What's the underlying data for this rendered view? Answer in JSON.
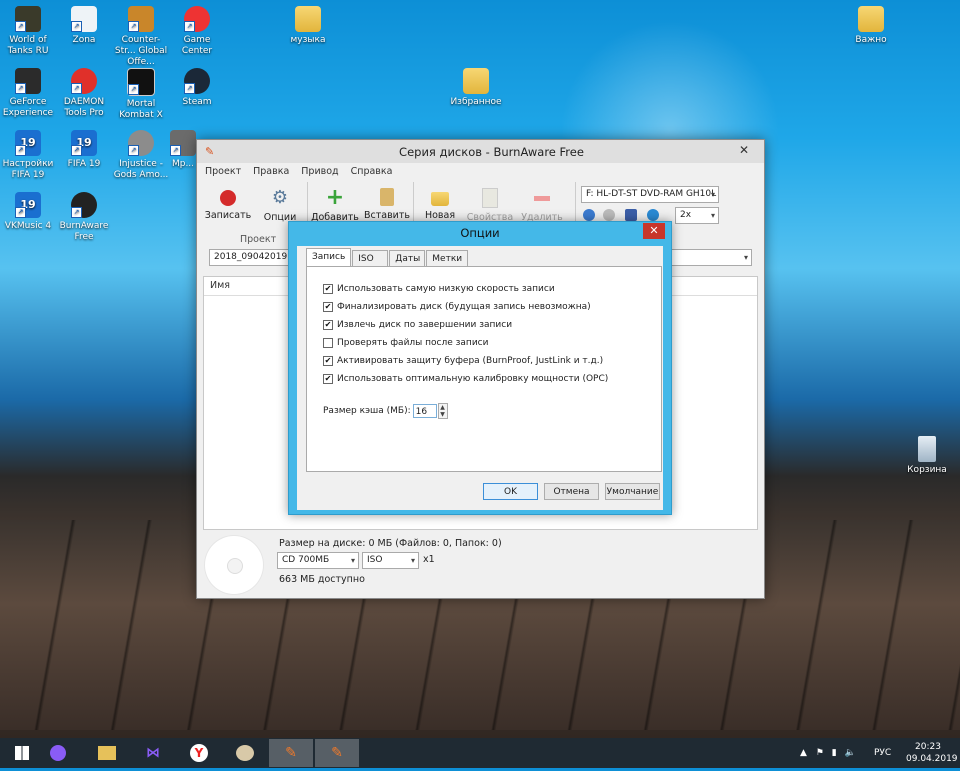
{
  "desktop": {
    "icons": [
      {
        "label": "World of Tanks RU",
        "icon": "wot-icon"
      },
      {
        "label": "Zona",
        "icon": "zona-icon"
      },
      {
        "label": "Counter-Str... Global Offe...",
        "icon": "csgo-icon"
      },
      {
        "label": "Game Center",
        "icon": "game-center-icon"
      },
      {
        "label": "музыка",
        "icon": "folder-icon"
      },
      {
        "label": "Важно",
        "icon": "folder-icon"
      },
      {
        "label": "GeForce Experience",
        "icon": "geforce-icon"
      },
      {
        "label": "DAEMON Tools Pro",
        "icon": "daemon-icon"
      },
      {
        "label": "Mortal Kombat X",
        "icon": "mkx-icon"
      },
      {
        "label": "Steam",
        "icon": "steam-icon"
      },
      {
        "label": "Избранное",
        "icon": "folder-icon"
      },
      {
        "label": "Настройки FIFA 19",
        "icon": "fifa-settings-icon"
      },
      {
        "label": "FIFA 19",
        "icon": "fifa-icon"
      },
      {
        "label": "Injustice - Gods Amo...",
        "icon": "injustice-icon"
      },
      {
        "label": "Mp...",
        "icon": "app-icon"
      },
      {
        "label": "VKMusic 4",
        "icon": "vkmusic-icon"
      },
      {
        "label": "BurnAware Free",
        "icon": "burnaware-icon"
      },
      {
        "label": "Корзина",
        "icon": "recycle-bin-icon"
      }
    ]
  },
  "window": {
    "title": "Серия дисков - BurnAware Free",
    "menu": [
      "Проект",
      "Правка",
      "Привод",
      "Справка"
    ],
    "toolbar": {
      "burn": "Записать",
      "options": "Опции",
      "group_project": "Проект",
      "add": "Добавить",
      "paste": "Вставить",
      "new_folder": "Новая папка",
      "properties": "Свойства",
      "delete": "Удалить",
      "drive": "F: HL-DT-ST DVD-RAM GH10L",
      "speed": "2x"
    },
    "project_name": "2018_09042019",
    "list_header": "Имя",
    "size_on_disk": "Размер на диске: 0 МБ (Файлов: 0, Папок: 0)",
    "disc_type": "CD 700МБ",
    "format": "ISO",
    "copies": "x1",
    "available": "663 МБ доступно"
  },
  "dialog": {
    "title": "Опции",
    "tabs": [
      "Запись",
      "ISO",
      "Даты",
      "Метки"
    ],
    "options": [
      {
        "label": "Использовать самую низкую скорость записи",
        "checked": true
      },
      {
        "label": "Финализировать диск (будущая запись невозможна)",
        "checked": true
      },
      {
        "label": "Извлечь диск по завершении записи",
        "checked": true
      },
      {
        "label": "Проверять файлы после записи",
        "checked": false
      },
      {
        "label": "Активировать защиту буфера (BurnProof, JustLink и т.д.)",
        "checked": true
      },
      {
        "label": "Использовать оптимальную калибровку мощности (OPC)",
        "checked": true
      }
    ],
    "cache_label": "Размер кэша (МБ):",
    "cache_value": "16",
    "ok": "OK",
    "cancel": "Отмена",
    "default": "Умолчание"
  },
  "taskbar": {
    "language": "РУС",
    "time": "20:23",
    "date": "09.04.2019"
  }
}
